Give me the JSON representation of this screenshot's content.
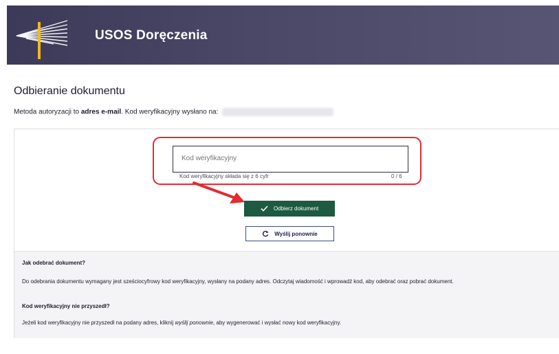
{
  "header": {
    "app_title": "USOS Doręczenia",
    "logo_icon": "university-columns-logo-icon",
    "background_color": "#4a4866"
  },
  "page": {
    "title": "Odbieranie dokumentu",
    "auth_prefix": "Metoda autoryzacji to ",
    "auth_method": "adres e-mail",
    "auth_suffix": ". Kod weryfikacyjny wysłano na:"
  },
  "form": {
    "code_placeholder": "Kod weryfikacyjny",
    "code_value": "",
    "helper_text": "Kod weryfikacyjny składa się z 6 cyfr",
    "counter": "0 / 6",
    "submit_label": "Odbierz dokument",
    "submit_icon": "check-icon",
    "submit_color": "#1c5a41",
    "resend_label": "Wyślij ponownie",
    "resend_icon": "refresh-icon"
  },
  "annotations": {
    "highlight_color": "#e32b33"
  },
  "info": {
    "heading1": "Jak odebrać dokument?",
    "paragraph1": "Do odebrania dokumentu wymagany jest sześciocyfrowy kod weryfikacyjny, wysłany na podany adres. Odczytaj wiadomość i wprowadź kod, aby odebrać oraz pobrać dokument.",
    "heading2": "Kod weryfikacyjny nie przyszedł?",
    "paragraph2_prefix": "Jeżeli kod weryfikacyjny nie przyszedł na podany adres, kliknij ",
    "paragraph2_em": "wyślij ponownie",
    "paragraph2_suffix": ", aby wygenerować i wysłać nowy kod weryfikacyjny."
  }
}
